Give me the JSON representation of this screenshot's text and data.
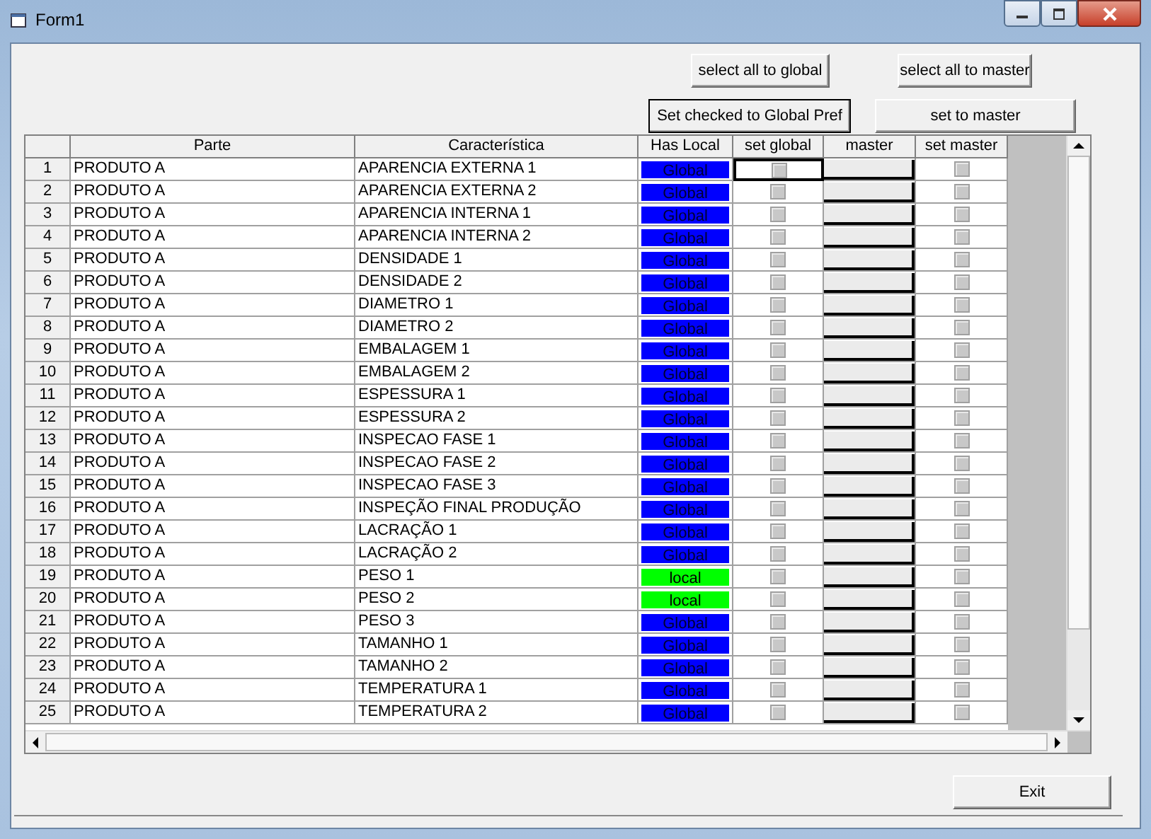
{
  "window": {
    "title": "Form1"
  },
  "buttons": {
    "select_all_global": "select all to global",
    "select_all_master": "select all to master",
    "set_checked_global": "Set checked to Global Pref",
    "set_to_master": "set to master",
    "exit": "Exit"
  },
  "table": {
    "columns": [
      "",
      "Parte",
      "Característica",
      "Has Local",
      "set global",
      "master",
      "set master"
    ],
    "rows": [
      {
        "index": "1",
        "parte": "PRODUTO A",
        "caracteristica": "APARENCIA EXTERNA 1",
        "kind": "global",
        "status": "Global",
        "set_global": false,
        "set_master": false,
        "focused": true
      },
      {
        "index": "2",
        "parte": "PRODUTO A",
        "caracteristica": "APARENCIA EXTERNA 2",
        "kind": "global",
        "status": "Global",
        "set_global": false,
        "set_master": false,
        "focused": false
      },
      {
        "index": "3",
        "parte": "PRODUTO A",
        "caracteristica": "APARENCIA INTERNA 1",
        "kind": "global",
        "status": "Global",
        "set_global": false,
        "set_master": false,
        "focused": false
      },
      {
        "index": "4",
        "parte": "PRODUTO A",
        "caracteristica": "APARENCIA INTERNA 2",
        "kind": "global",
        "status": "Global",
        "set_global": false,
        "set_master": false,
        "focused": false
      },
      {
        "index": "5",
        "parte": "PRODUTO A",
        "caracteristica": "DENSIDADE 1",
        "kind": "global",
        "status": "Global",
        "set_global": false,
        "set_master": false,
        "focused": false
      },
      {
        "index": "6",
        "parte": "PRODUTO A",
        "caracteristica": "DENSIDADE 2",
        "kind": "global",
        "status": "Global",
        "set_global": false,
        "set_master": false,
        "focused": false
      },
      {
        "index": "7",
        "parte": "PRODUTO A",
        "caracteristica": "DIAMETRO 1",
        "kind": "global",
        "status": "Global",
        "set_global": false,
        "set_master": false,
        "focused": false
      },
      {
        "index": "8",
        "parte": "PRODUTO A",
        "caracteristica": "DIAMETRO 2",
        "kind": "global",
        "status": "Global",
        "set_global": false,
        "set_master": false,
        "focused": false
      },
      {
        "index": "9",
        "parte": "PRODUTO A",
        "caracteristica": "EMBALAGEM 1",
        "kind": "global",
        "status": "Global",
        "set_global": false,
        "set_master": false,
        "focused": false
      },
      {
        "index": "10",
        "parte": "PRODUTO A",
        "caracteristica": "EMBALAGEM 2",
        "kind": "global",
        "status": "Global",
        "set_global": false,
        "set_master": false,
        "focused": false
      },
      {
        "index": "11",
        "parte": "PRODUTO A",
        "caracteristica": "ESPESSURA 1",
        "kind": "global",
        "status": "Global",
        "set_global": false,
        "set_master": false,
        "focused": false
      },
      {
        "index": "12",
        "parte": "PRODUTO A",
        "caracteristica": "ESPESSURA 2",
        "kind": "global",
        "status": "Global",
        "set_global": false,
        "set_master": false,
        "focused": false
      },
      {
        "index": "13",
        "parte": "PRODUTO A",
        "caracteristica": "INSPECAO FASE 1",
        "kind": "global",
        "status": "Global",
        "set_global": false,
        "set_master": false,
        "focused": false
      },
      {
        "index": "14",
        "parte": "PRODUTO A",
        "caracteristica": "INSPECAO FASE 2",
        "kind": "global",
        "status": "Global",
        "set_global": false,
        "set_master": false,
        "focused": false
      },
      {
        "index": "15",
        "parte": "PRODUTO A",
        "caracteristica": "INSPECAO FASE 3",
        "kind": "global",
        "status": "Global",
        "set_global": false,
        "set_master": false,
        "focused": false
      },
      {
        "index": "16",
        "parte": "PRODUTO A",
        "caracteristica": "INSPEÇÃO FINAL PRODUÇÃO",
        "kind": "global",
        "status": "Global",
        "set_global": false,
        "set_master": false,
        "focused": false
      },
      {
        "index": "17",
        "parte": "PRODUTO A",
        "caracteristica": "LACRAÇÃO 1",
        "kind": "global",
        "status": "Global",
        "set_global": false,
        "set_master": false,
        "focused": false
      },
      {
        "index": "18",
        "parte": "PRODUTO A",
        "caracteristica": "LACRAÇÃO 2",
        "kind": "global",
        "status": "Global",
        "set_global": false,
        "set_master": false,
        "focused": false
      },
      {
        "index": "19",
        "parte": "PRODUTO A",
        "caracteristica": "PESO 1",
        "kind": "local",
        "status": "local",
        "set_global": false,
        "set_master": false,
        "focused": false
      },
      {
        "index": "20",
        "parte": "PRODUTO A",
        "caracteristica": "PESO 2",
        "kind": "local",
        "status": "local",
        "set_global": false,
        "set_master": false,
        "focused": false
      },
      {
        "index": "21",
        "parte": "PRODUTO A",
        "caracteristica": "PESO 3",
        "kind": "global",
        "status": "Global",
        "set_global": false,
        "set_master": false,
        "focused": false
      },
      {
        "index": "22",
        "parte": "PRODUTO A",
        "caracteristica": "TAMANHO 1",
        "kind": "global",
        "status": "Global",
        "set_global": false,
        "set_master": false,
        "focused": false
      },
      {
        "index": "23",
        "parte": "PRODUTO A",
        "caracteristica": "TAMANHO 2",
        "kind": "global",
        "status": "Global",
        "set_global": false,
        "set_master": false,
        "focused": false
      },
      {
        "index": "24",
        "parte": "PRODUTO A",
        "caracteristica": "TEMPERATURA 1",
        "kind": "global",
        "status": "Global",
        "set_global": false,
        "set_master": false,
        "focused": false
      },
      {
        "index": "25",
        "parte": "PRODUTO A",
        "caracteristica": "TEMPERATURA 2",
        "kind": "global",
        "status": "Global",
        "set_global": false,
        "set_master": false,
        "focused": false
      }
    ]
  }
}
